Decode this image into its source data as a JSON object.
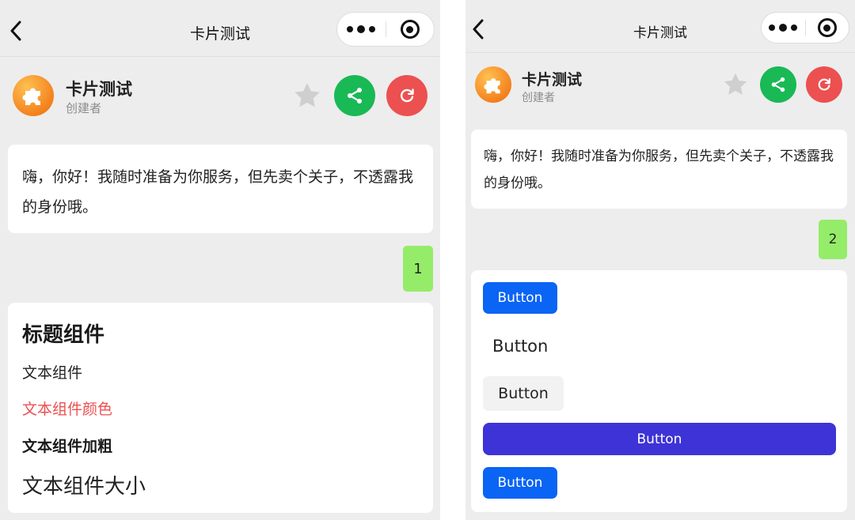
{
  "left": {
    "nav": {
      "title": "卡片测试"
    },
    "bot": {
      "name": "卡片测试",
      "role": "创建者"
    },
    "welcome": "嗨，你好！我随时准备为你服务，但先卖个关子，不透露我的身份哦。",
    "user_message": "1",
    "components": {
      "title": "标题组件",
      "text": "文本组件",
      "colored_text": "文本组件颜色",
      "bold_text": "文本组件加粗",
      "large_text": "文本组件大小"
    }
  },
  "right": {
    "nav": {
      "title": "卡片测试"
    },
    "bot": {
      "name": "卡片测试",
      "role": "创建者"
    },
    "welcome": "嗨，你好！我随时准备为你服务，但先卖个关子，不透露我的身份哦。",
    "user_message": "2",
    "buttons": [
      "Button",
      "Button",
      "Button",
      "Button",
      "Button"
    ]
  },
  "icons": {
    "back": "chevron-left-icon",
    "menu": "more-dots-icon",
    "close": "target-circle-icon",
    "avatar": "puzzle-piece-icon",
    "favorite": "star-icon",
    "share": "share-icon",
    "reset": "refresh-icon"
  },
  "colors": {
    "share": "#19b955",
    "reset": "#ec5050",
    "user_bubble": "#95ec69",
    "red_text": "#ec4f4f",
    "primary_button": "#0a64f4",
    "wide_button": "#3e33d6",
    "avatar": "#f37d1a"
  }
}
